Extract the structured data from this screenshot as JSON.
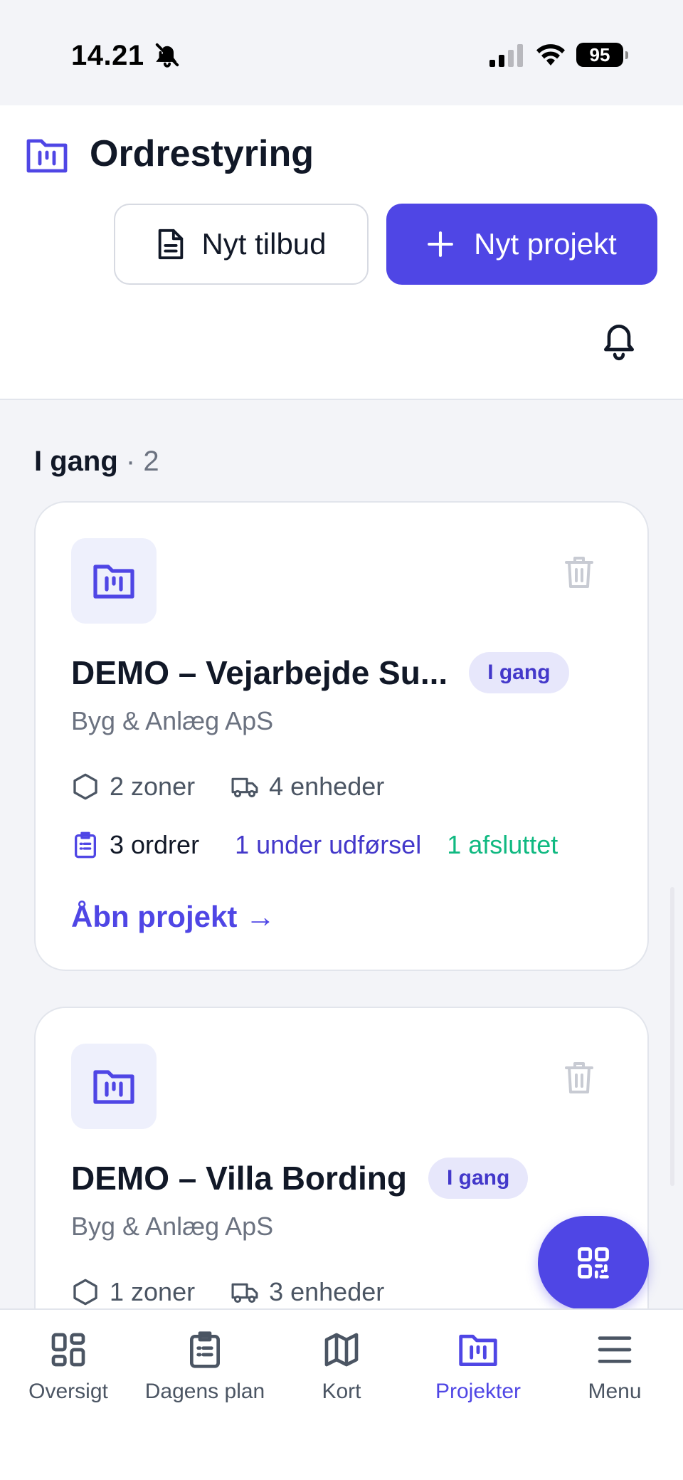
{
  "status_bar": {
    "time": "14.21",
    "battery": "95"
  },
  "header": {
    "title": "Ordrestyring",
    "new_offer_label": "Nyt tilbud",
    "new_project_label": "Nyt projekt"
  },
  "section": {
    "label": "I gang",
    "separator": "·",
    "count": "2"
  },
  "projects": [
    {
      "title": "DEMO – Vejarbejde Su...",
      "status": "I gang",
      "company": "Byg & Anlæg ApS",
      "zones": "2 zoner",
      "units": "4 enheder",
      "orders": "3 ordrer",
      "in_progress": "1 under udførsel",
      "completed": "1 afsluttet",
      "open_label": "Åbn projekt →"
    },
    {
      "title": "DEMO – Villa Bording",
      "status": "I gang",
      "company": "Byg & Anlæg ApS",
      "zones": "1 zoner",
      "units": "3 enheder"
    }
  ],
  "nav": {
    "items": [
      {
        "label": "Oversigt",
        "icon": "grid-icon"
      },
      {
        "label": "Dagens plan",
        "icon": "clipboard-icon"
      },
      {
        "label": "Kort",
        "icon": "map-icon"
      },
      {
        "label": "Projekter",
        "icon": "folder-icon"
      },
      {
        "label": "Menu",
        "icon": "menu-icon"
      }
    ],
    "active": "Projekter"
  },
  "colors": {
    "accent": "#4f46e5",
    "pill_bg": "#e7e7fb",
    "success": "#10b981",
    "background": "#f3f4f8"
  }
}
